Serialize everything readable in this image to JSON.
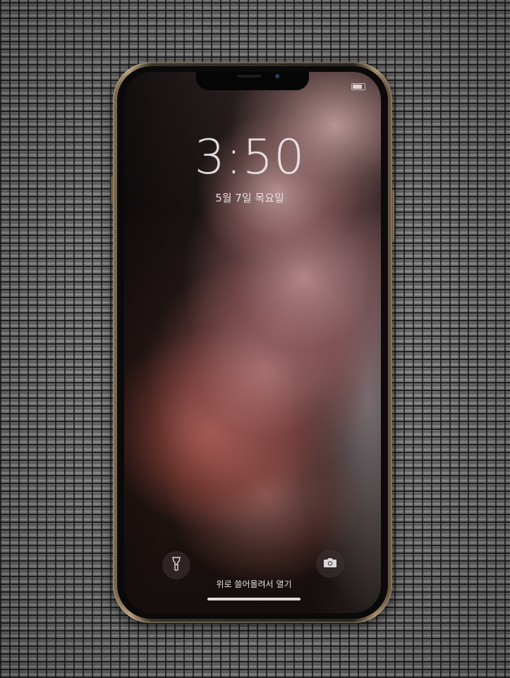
{
  "lock_screen": {
    "time": "3:50",
    "date": "5월 7일 목요일",
    "swipe_hint": "위로 쓸어올려서 열기"
  },
  "icons": {
    "flashlight": "flashlight-icon",
    "camera": "camera-icon",
    "battery": "battery-icon"
  },
  "colors": {
    "phone_frame": "#b69c78",
    "screen_text": "#f0ecf0",
    "wallpaper_accent": "#c8787a"
  }
}
